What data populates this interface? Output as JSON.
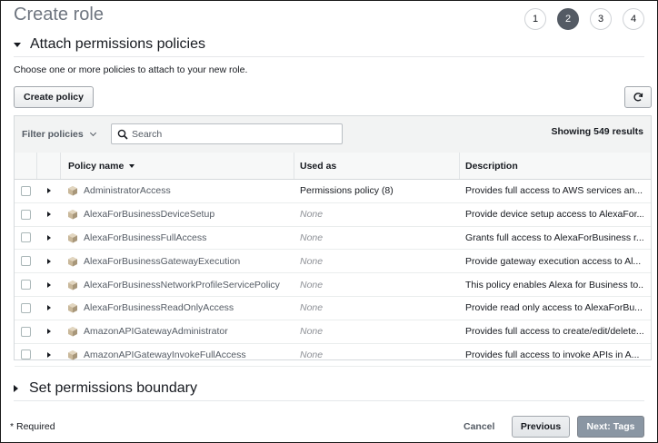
{
  "page": {
    "title": "Create role"
  },
  "steps": [
    "1",
    "2",
    "3",
    "4"
  ],
  "active_step": "2",
  "attach_section": {
    "title": "Attach permissions policies",
    "description": "Choose one or more policies to attach to your new role.",
    "create_policy_label": "Create policy"
  },
  "filter": {
    "label": "Filter policies",
    "search_placeholder": "Search",
    "showing": "Showing 549 results"
  },
  "table": {
    "columns": [
      "Policy name",
      "Used as",
      "Description"
    ],
    "rows": [
      {
        "name": "AdministratorAccess",
        "used_as": "Permissions policy (8)",
        "description": "Provides full access to AWS services an..."
      },
      {
        "name": "AlexaForBusinessDeviceSetup",
        "used_as": "None",
        "description": "Provide device setup access to AlexaFor..."
      },
      {
        "name": "AlexaForBusinessFullAccess",
        "used_as": "None",
        "description": "Grants full access to AlexaForBusiness r..."
      },
      {
        "name": "AlexaForBusinessGatewayExecution",
        "used_as": "None",
        "description": "Provide gateway execution access to Al..."
      },
      {
        "name": "AlexaForBusinessNetworkProfileServicePolicy",
        "used_as": "None",
        "description": "This policy enables Alexa for Business to..."
      },
      {
        "name": "AlexaForBusinessReadOnlyAccess",
        "used_as": "None",
        "description": "Provide read only access to AlexaForBu..."
      },
      {
        "name": "AmazonAPIGatewayAdministrator",
        "used_as": "None",
        "description": "Provides full access to create/edit/delete..."
      },
      {
        "name": "AmazonAPIGatewayInvokeFullAccess",
        "used_as": "None",
        "description": "Provides full access to invoke APIs in A..."
      }
    ]
  },
  "boundary_section": {
    "title": "Set permissions boundary"
  },
  "footer": {
    "required": "* Required",
    "cancel": "Cancel",
    "previous": "Previous",
    "next": "Next: Tags"
  },
  "colors": {
    "active_step": "#545b64",
    "next_button": "#8a96a3"
  },
  "icons": {
    "refresh": "refresh-icon",
    "search": "search-icon",
    "policy": "policy-cube-icon"
  }
}
